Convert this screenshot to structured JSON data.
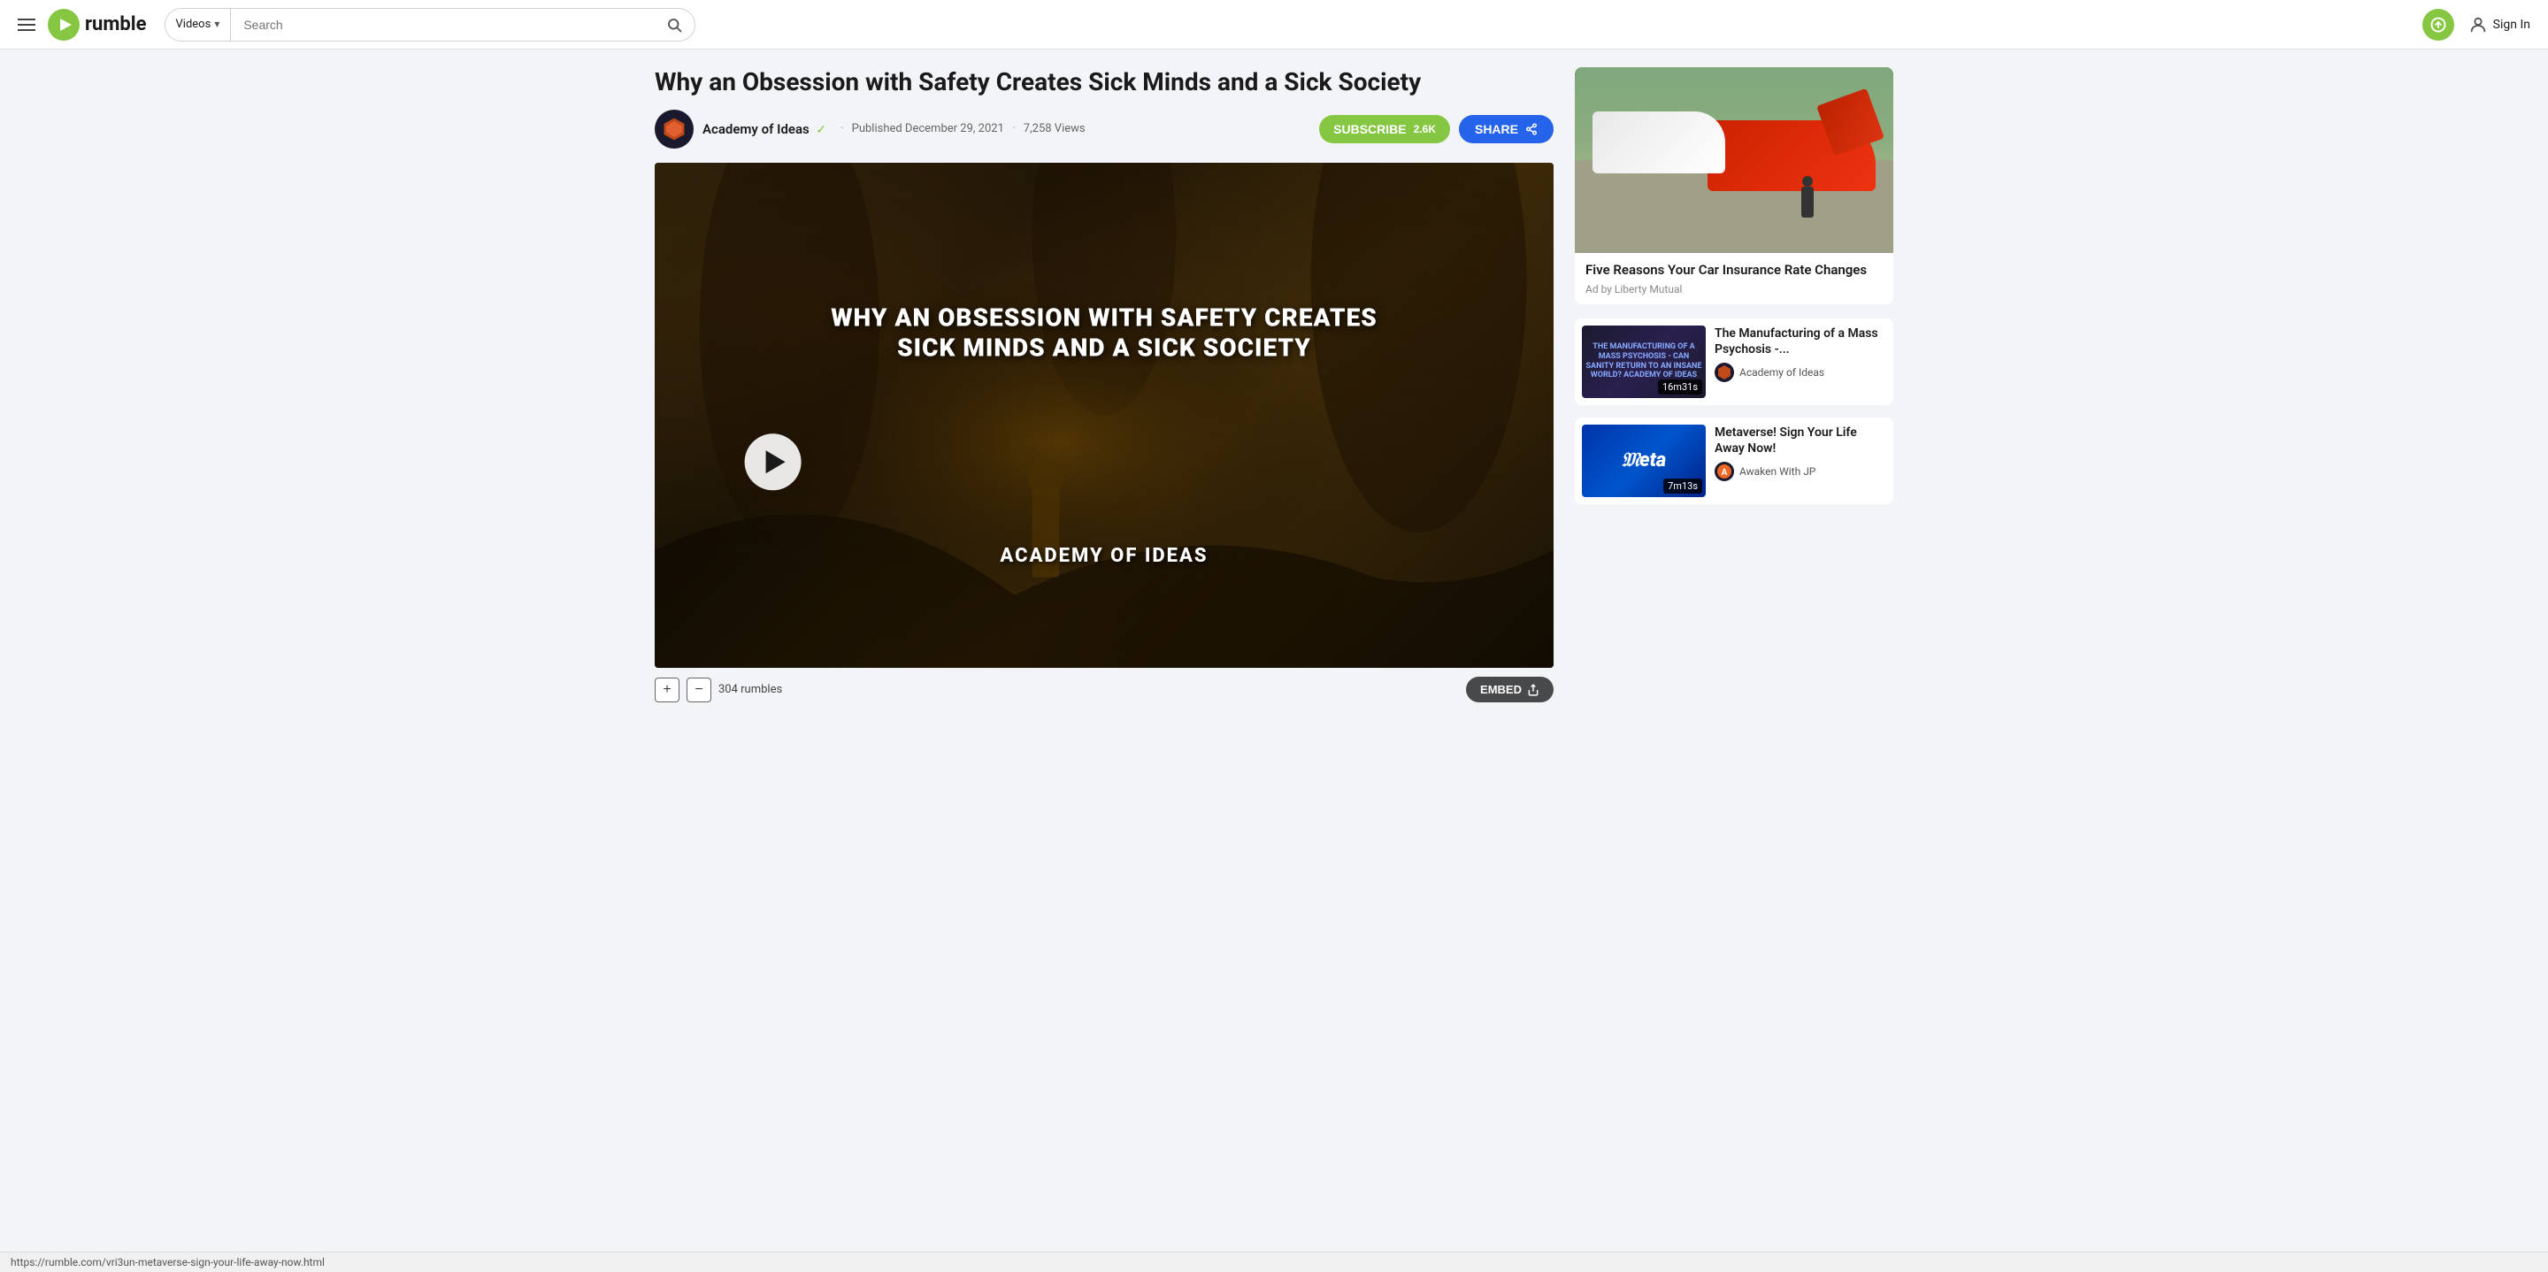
{
  "header": {
    "search_placeholder": "Search",
    "search_category": "Videos",
    "sign_in_label": "Sign In",
    "logo_text": "rumble"
  },
  "video": {
    "title": "Why an Obsession with Safety Creates Sick Minds and a Sick Society",
    "title_overlay_line1": "WHY AN OBSESSION WITH SAFETY CREATES",
    "title_overlay_line2": "SICK MINDS AND A SICK SOCIETY",
    "subtitle_overlay": "ACADEMY OF IDEAS",
    "published": "Published December 29, 2021",
    "views": "7,258 Views",
    "rumbles": "304 rumbles",
    "embed_label": "EMBED"
  },
  "channel": {
    "name": "Academy of Ideas",
    "verified": true,
    "subscribe_label": "SUBSCRIBE",
    "subscribe_count": "2.6K",
    "share_label": "SHARE"
  },
  "sidebar": {
    "ad": {
      "title": "Five Reasons Your Car Insurance Rate Changes",
      "source": "Ad by Liberty Mutual"
    },
    "related_videos": [
      {
        "id": "manufacturing",
        "title": "The Manufacturing of a Mass Psychosis -...",
        "channel": "Academy of Ideas",
        "duration": "16m31s",
        "thumb_text": "THE MANUFACTURING OF A MASS PSYCHOSIS - CAN SANITY RETURN TO AN INSANE WORLD?\nACADEMY OF IDEAS"
      },
      {
        "id": "metaverse",
        "title": "Metaverse! Sign Your Life Away Now!",
        "channel": "Awaken With JP",
        "duration": "7m13s",
        "thumb_text": "Meta"
      }
    ]
  },
  "status_bar": {
    "url": "https://rumble.com/vri3un-metaverse-sign-your-life-away-now.html"
  }
}
